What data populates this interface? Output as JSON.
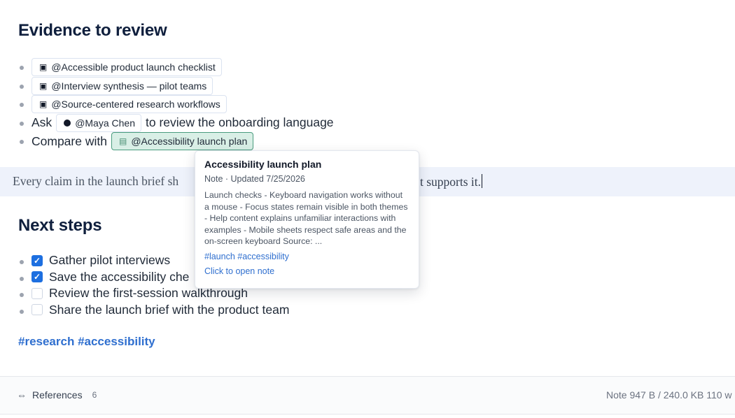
{
  "evidence": {
    "heading": "Evidence to review",
    "items": [
      {
        "type": "chip",
        "icon": "note-icon",
        "label": "@Accessible product launch checklist"
      },
      {
        "type": "chip",
        "icon": "note-icon",
        "label": "@Interview synthesis — pilot teams"
      },
      {
        "type": "chip",
        "icon": "note-icon",
        "label": "@Source-centered research workflows"
      },
      {
        "type": "mention",
        "prefix": "Ask",
        "chip_label": "@Maya Chen",
        "suffix": "to review the onboarding language"
      },
      {
        "type": "mention",
        "prefix": "Compare with",
        "chip_label": "@Accessibility launch plan"
      }
    ]
  },
  "quote": {
    "text_left": "Every claim in the launch brief sh",
    "text_right": "t supports it."
  },
  "next_steps": {
    "heading": "Next steps",
    "items": [
      {
        "label": "Gather pilot interviews",
        "checked": true
      },
      {
        "label": "Save the accessibility che",
        "checked": true
      },
      {
        "label": "Review the first-session walkthrough",
        "checked": false
      },
      {
        "label": "Share the launch brief with the product team",
        "checked": false
      }
    ]
  },
  "tags_line": "#research #accessibility",
  "footer": {
    "references_label": "References",
    "references_count": "6",
    "stats": "Note 947 B / 240.0 KB   110 w"
  },
  "popup": {
    "title": "Accessibility launch plan",
    "meta": "Note · Updated 7/25/2026",
    "body": "Launch checks - Keyboard navigation works without a mouse - Focus states remain visible in both themes - Help content explains unfamiliar interactions with examples - Mobile sheets respect safe areas and the on-screen keyboard Source: ...",
    "tags": "#launch #accessibility",
    "open_label": "Click to open note"
  },
  "colors": {
    "accent": "#1d6fe0",
    "tag_blue": "#2f6fcf",
    "active_chip_bg": "#d9efe6",
    "quote_bg": "#eef2fb"
  }
}
